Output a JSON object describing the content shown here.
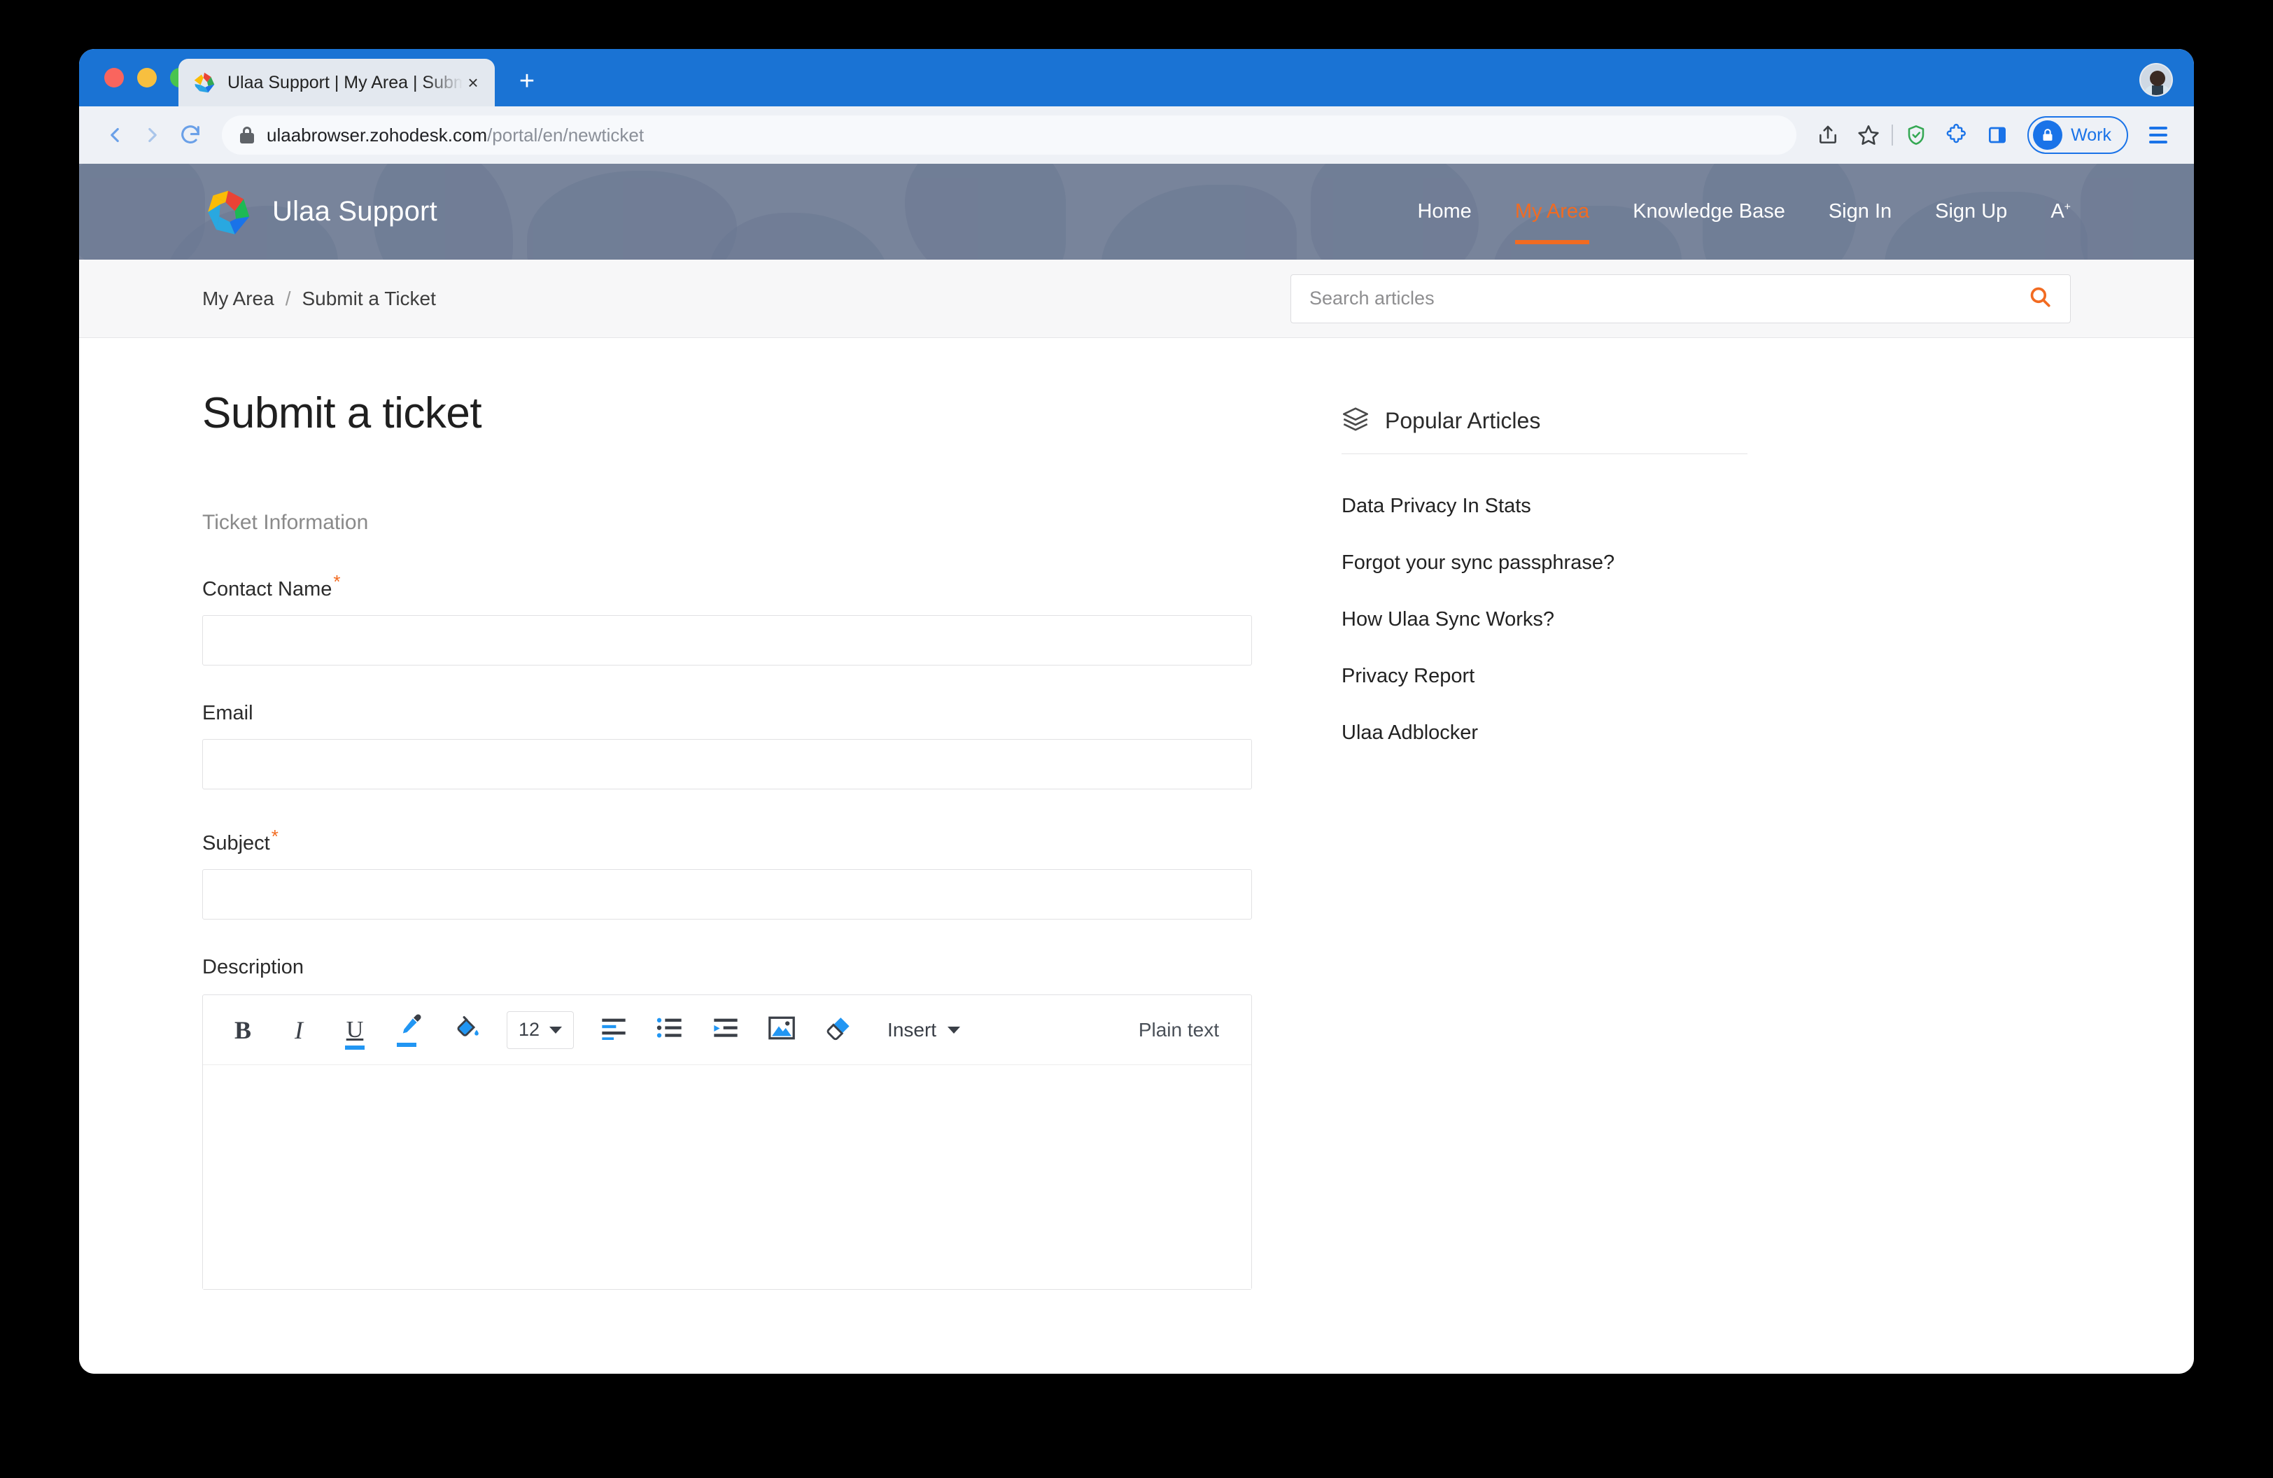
{
  "browser": {
    "tab": {
      "title": "Ulaa Support | My Area | Submit",
      "favicon_name": "ulaa-logo-favicon",
      "close_label": "×"
    },
    "new_tab_label": "+",
    "toolbar": {
      "back_label": "‹",
      "forward_label": "›",
      "reload_label": "⟳",
      "url_host": "ulaabrowser.zohodesk.com",
      "url_path": "/portal/en/newticket",
      "profile_label": "Work",
      "icons": [
        "share-icon",
        "bookmark-star-icon",
        "shield-check-icon",
        "extensions-puzzle-icon",
        "side-panel-icon"
      ]
    }
  },
  "site": {
    "brand_name": "Ulaa Support",
    "nav": [
      {
        "label": "Home",
        "active": false
      },
      {
        "label": "My Area",
        "active": true
      },
      {
        "label": "Knowledge Base",
        "active": false
      },
      {
        "label": "Sign In",
        "active": false
      },
      {
        "label": "Sign Up",
        "active": false
      }
    ],
    "lang_label": "A",
    "lang_sup": "+",
    "accent_color": "#f26b21",
    "header_bg": "#78849b"
  },
  "breadcrumb": {
    "items": [
      "My Area",
      "Submit a Ticket"
    ],
    "separator": "/"
  },
  "search": {
    "placeholder": "Search articles",
    "value": "",
    "icon": "search-icon"
  },
  "form": {
    "title": "Submit a ticket",
    "section_label": "Ticket Information",
    "required_marker": "*",
    "fields": [
      {
        "label": "Contact Name",
        "required": true,
        "value": ""
      },
      {
        "label": "Email",
        "required": false,
        "value": ""
      },
      {
        "label": "Subject",
        "required": true,
        "value": ""
      }
    ],
    "description": {
      "label": "Description",
      "value": "",
      "toolbar": {
        "bold": "B",
        "italic": "I",
        "underline": "U",
        "text_color_icon": "text-color-eyedropper-icon",
        "fill_color_icon": "fill-color-bucket-icon",
        "font_size": "12",
        "align_icon": "align-left-icon",
        "list_icon": "bulleted-list-icon",
        "indent_icon": "indent-increase-icon",
        "image_icon": "insert-image-icon",
        "clear_icon": "clear-formatting-eraser-icon",
        "insert_label": "Insert",
        "plain_text_label": "Plain text"
      }
    }
  },
  "popular": {
    "title": "Popular Articles",
    "icon": "layers-icon",
    "articles": [
      "Data Privacy In Stats",
      "Forgot your sync passphrase?",
      "How Ulaa Sync Works?",
      "Privacy Report",
      "Ulaa Adblocker"
    ]
  }
}
